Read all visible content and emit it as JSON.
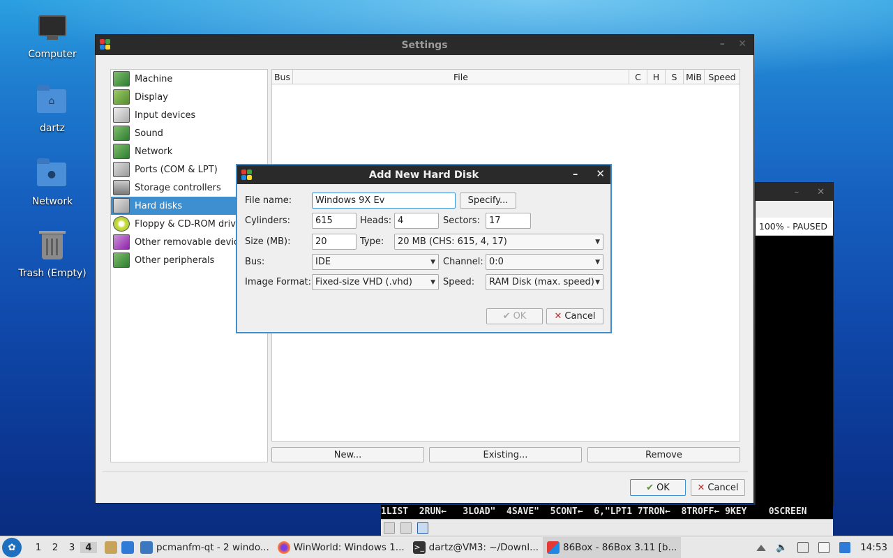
{
  "desktop": {
    "icons": [
      {
        "label": "Computer"
      },
      {
        "label": "dartz"
      },
      {
        "label": "Network"
      },
      {
        "label": "Trash (Empty)"
      }
    ]
  },
  "settings": {
    "title": "Settings",
    "categories": [
      {
        "label": "Machine"
      },
      {
        "label": "Display"
      },
      {
        "label": "Input devices"
      },
      {
        "label": "Sound"
      },
      {
        "label": "Network"
      },
      {
        "label": "Ports (COM & LPT)"
      },
      {
        "label": "Storage controllers"
      },
      {
        "label": "Hard disks",
        "selected": true
      },
      {
        "label": "Floppy & CD-ROM drives"
      },
      {
        "label": "Other removable devices"
      },
      {
        "label": "Other peripherals"
      }
    ],
    "table_columns": [
      "Bus",
      "File",
      "C",
      "H",
      "S",
      "MiB",
      "Speed"
    ],
    "buttons": {
      "new": "New...",
      "existing": "Existing...",
      "remove": "Remove"
    },
    "ok": "OK",
    "cancel": "Cancel"
  },
  "dialog": {
    "title": "Add New Hard Disk",
    "file_name_label": "File name:",
    "file_name_value": "Windows 9X Ev",
    "specify": "Specify...",
    "cylinders_label": "Cylinders:",
    "cylinders_value": "615",
    "heads_label": "Heads:",
    "heads_value": "4",
    "sectors_label": "Sectors:",
    "sectors_value": "17",
    "size_label": "Size (MB):",
    "size_value": "20",
    "type_label": "Type:",
    "type_value": "20 MB (CHS: 615, 4, 17)",
    "bus_label": "Bus:",
    "bus_value": "IDE",
    "channel_label": "Channel:",
    "channel_value": "0:0",
    "format_label": "Image Format:",
    "format_value": "Fixed-size VHD (.vhd)",
    "speed_label": "Speed:",
    "speed_value": "RAM Disk (max. speed)",
    "ok": "OK",
    "cancel": "Cancel"
  },
  "emulator": {
    "status": "100% - PAUSED",
    "basic_keys": "1LIST  2RUN←   3LOAD\"  4SAVE\"  5CONT←  6,\"LPT1 7TRON←  8TROFF← 9KEY    0SCREEN"
  },
  "taskbar": {
    "desktops": [
      "1",
      "2",
      "3",
      "4"
    ],
    "tasks": [
      {
        "label": "pcmanfm-qt - 2 windo..."
      },
      {
        "label": "WinWorld: Windows 1..."
      },
      {
        "label": "dartz@VM3: ~/Downl..."
      },
      {
        "label": "86Box - 86Box 3.11 [b..."
      }
    ],
    "clock": "14:53"
  },
  "colors": {
    "selection": "#3e8fd0",
    "titlebar": "#2a2a2a",
    "window_bg": "#efefef"
  }
}
